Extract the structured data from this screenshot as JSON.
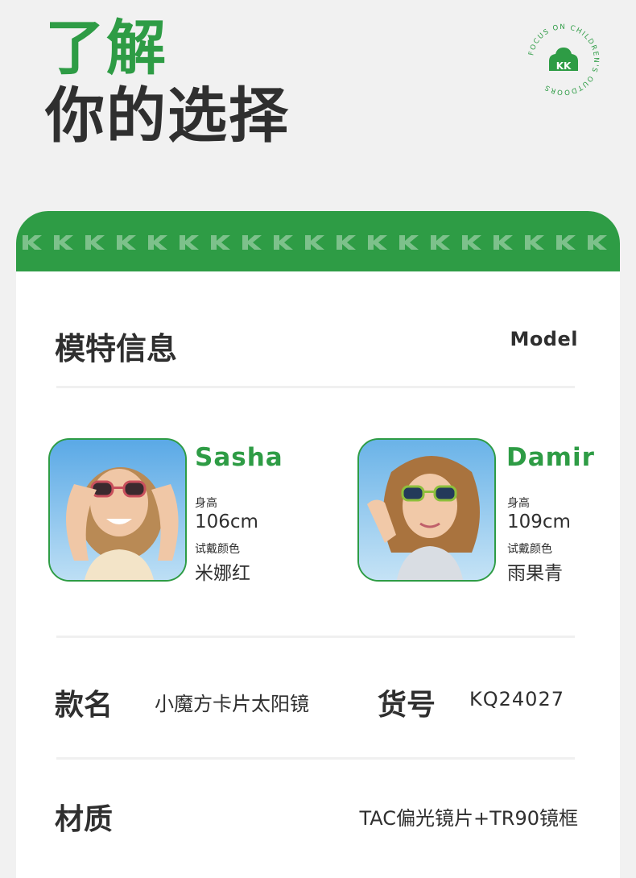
{
  "hero": {
    "line1": "了解",
    "line2": "你的选择"
  },
  "badge": {
    "ring_text": "FOCUS ON CHILDREN'S OUTDOORS",
    "logo_text": "KK"
  },
  "header": {
    "pattern_letter": "K"
  },
  "model_section": {
    "title": "模特信息",
    "subtitle": "Model"
  },
  "models": [
    {
      "name": "Sasha",
      "height_label": "身高",
      "height": "106cm",
      "color_label": "试戴颜色",
      "color": "米娜红"
    },
    {
      "name": "Damir",
      "height_label": "身高",
      "height": "109cm",
      "color_label": "试戴颜色",
      "color": "雨果青"
    }
  ],
  "product": {
    "name_label": "款名",
    "name_value": "小魔方卡片太阳镜",
    "sku_label": "货号",
    "sku_value": "KQ24027"
  },
  "material": {
    "label": "材质",
    "value": "TAC偏光镜片+TR90镜框"
  },
  "colors": {
    "brand_green": "#2e9c45",
    "text_dark": "#2f2f2f",
    "page_bg": "#f1f1f1"
  }
}
